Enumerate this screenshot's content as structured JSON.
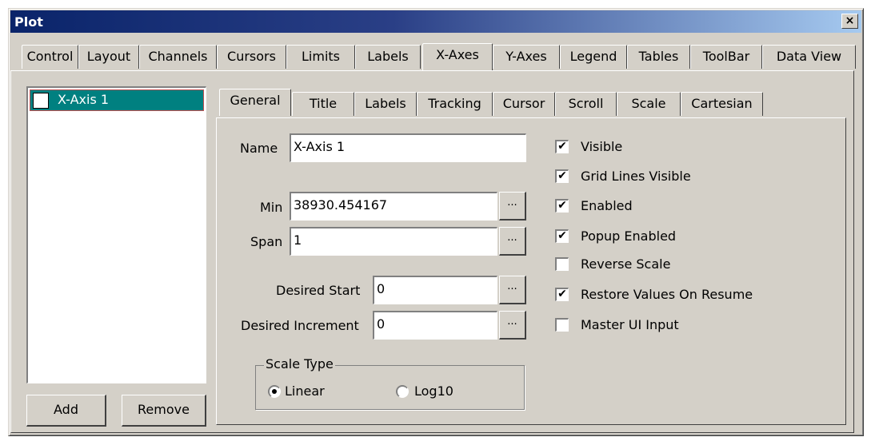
{
  "window": {
    "title": "Plot",
    "close_glyph": "×",
    "close_icon": "close-icon"
  },
  "outer_tabs": [
    "Control",
    "Layout",
    "Channels",
    "Cursors",
    "Limits",
    "Labels",
    "X-Axes",
    "Y-Axes",
    "Legend",
    "Tables",
    "ToolBar",
    "Data View"
  ],
  "outer_active_tab": "X-Axes",
  "axis_list": {
    "items": [
      {
        "label": "X-Axis 1",
        "selected": true
      }
    ]
  },
  "buttons": {
    "add": "Add",
    "remove": "Remove"
  },
  "inner_tabs": [
    "General",
    "Title",
    "Labels",
    "Tracking",
    "Cursor",
    "Scroll",
    "Scale",
    "Cartesian"
  ],
  "inner_active_tab": "General",
  "general": {
    "name_label": "Name",
    "name_value": "X-Axis 1",
    "min_label": "Min",
    "min_value": "38930.454167",
    "span_label": "Span",
    "span_value": "1",
    "desired_start_label": "Desired Start",
    "desired_start_value": "0",
    "desired_increment_label": "Desired Increment",
    "desired_increment_value": "0",
    "ellipsis": "...",
    "checkboxes": [
      {
        "label": "Visible",
        "checked": true
      },
      {
        "label": "Grid Lines Visible",
        "checked": true
      },
      {
        "label": "Enabled",
        "checked": true
      },
      {
        "label": "Popup Enabled",
        "checked": true
      },
      {
        "label": "Reverse Scale",
        "checked": false
      },
      {
        "label": "Restore Values On Resume",
        "checked": true
      },
      {
        "label": "Master UI Input",
        "checked": false
      }
    ],
    "check_mark": "✔",
    "scale_type": {
      "title": "Scale Type",
      "options": [
        {
          "label": "Linear",
          "selected": true
        },
        {
          "label": "Log10",
          "selected": false
        }
      ]
    }
  },
  "colors": {
    "title_bar": "#0a246a",
    "selection": "#008080",
    "face": "#d4d0c8"
  }
}
